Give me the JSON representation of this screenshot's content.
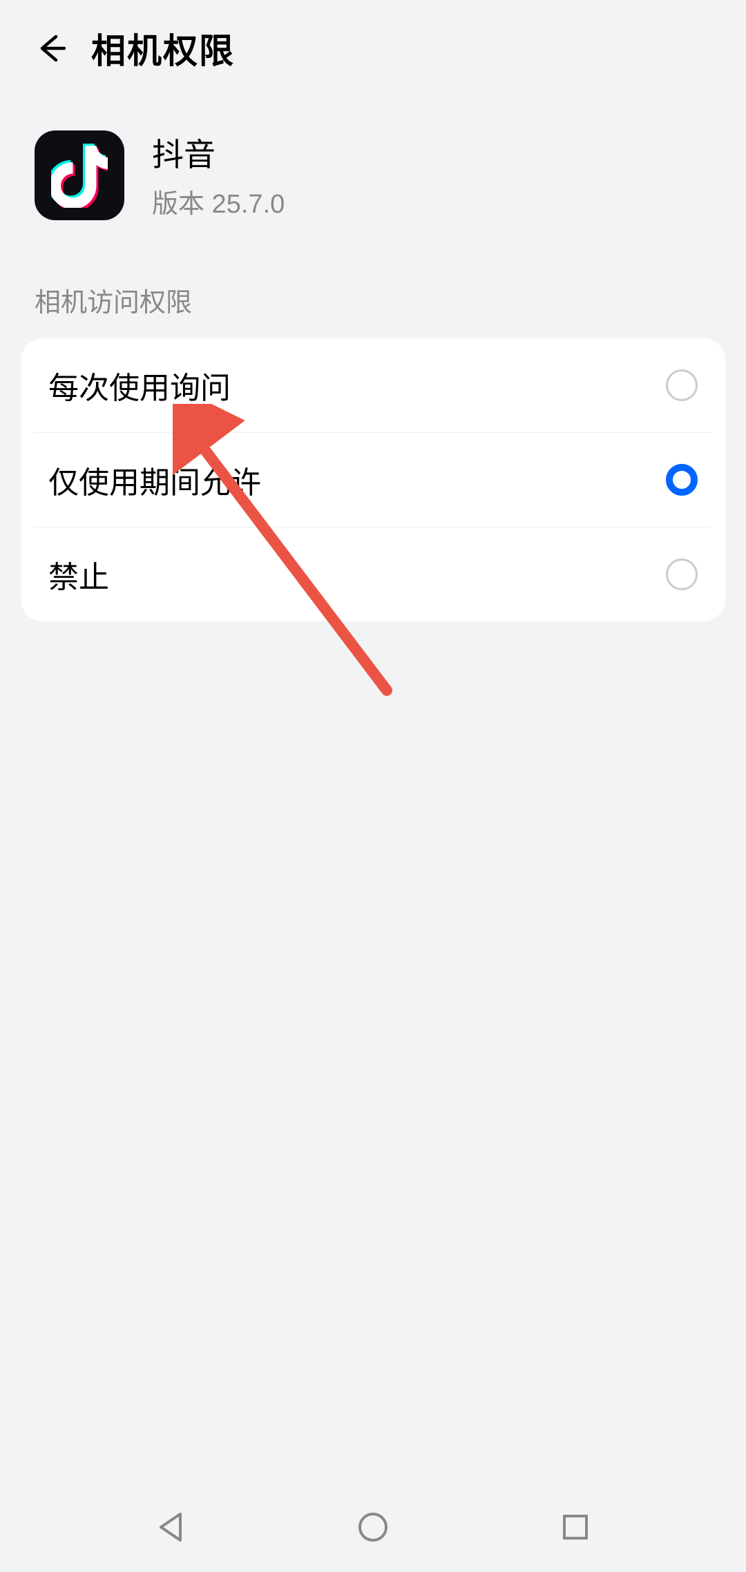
{
  "header": {
    "title": "相机权限"
  },
  "app": {
    "name": "抖音",
    "version": "版本 25.7.0"
  },
  "section": {
    "label": "相机访问权限"
  },
  "options": [
    {
      "label": "每次使用询问",
      "selected": false
    },
    {
      "label": "仅使用期间允许",
      "selected": true
    },
    {
      "label": "禁止",
      "selected": false
    }
  ]
}
